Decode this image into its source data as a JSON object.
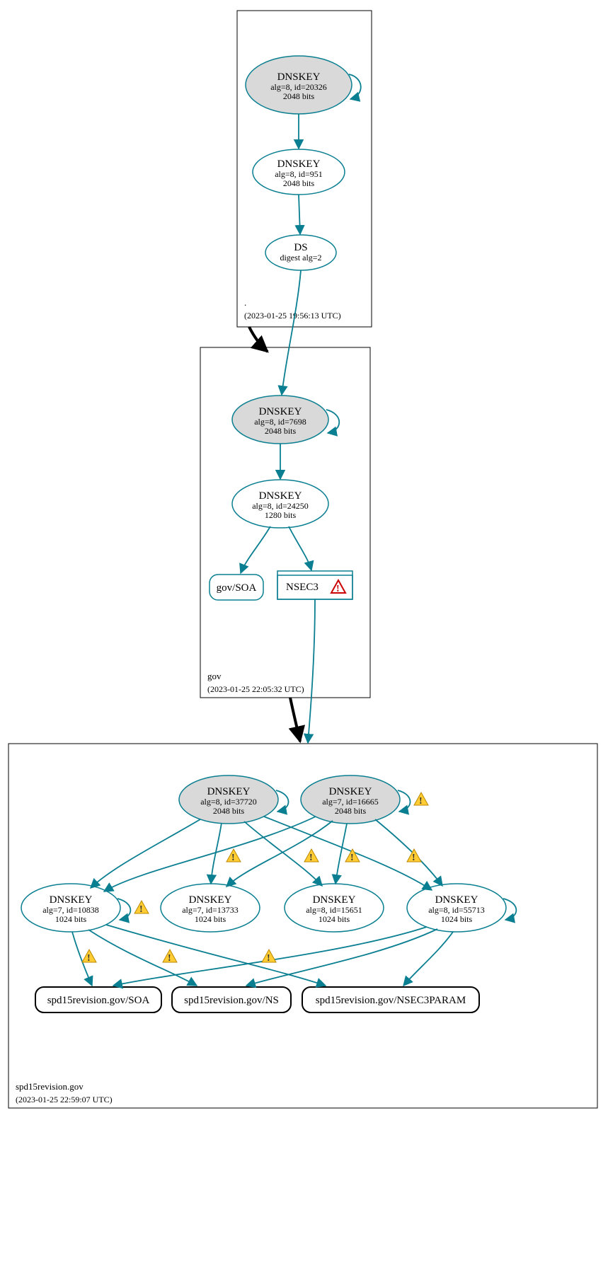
{
  "zones": {
    "root": {
      "name": ".",
      "ts": "(2023-01-25 19:56:13 UTC)"
    },
    "gov": {
      "name": "gov",
      "ts": "(2023-01-25 22:05:32 UTC)"
    },
    "leaf": {
      "name": "spd15revision.gov",
      "ts": "(2023-01-25 22:59:07 UTC)"
    }
  },
  "nodes": {
    "root_ksk": {
      "t": "DNSKEY",
      "l1": "alg=8, id=20326",
      "l2": "2048 bits"
    },
    "root_zsk": {
      "t": "DNSKEY",
      "l1": "alg=8, id=951",
      "l2": "2048 bits"
    },
    "root_ds": {
      "t": "DS",
      "l1": "digest alg=2"
    },
    "gov_ksk": {
      "t": "DNSKEY",
      "l1": "alg=8, id=7698",
      "l2": "2048 bits"
    },
    "gov_zsk": {
      "t": "DNSKEY",
      "l1": "alg=8, id=24250",
      "l2": "1280 bits"
    },
    "gov_soa": {
      "t": "gov/SOA"
    },
    "gov_nsec3": {
      "t": "NSEC3"
    },
    "leaf_ksk8": {
      "t": "DNSKEY",
      "l1": "alg=8, id=37720",
      "l2": "2048 bits"
    },
    "leaf_ksk7": {
      "t": "DNSKEY",
      "l1": "alg=7, id=16665",
      "l2": "2048 bits"
    },
    "leaf_z1": {
      "t": "DNSKEY",
      "l1": "alg=7, id=10838",
      "l2": "1024 bits"
    },
    "leaf_z2": {
      "t": "DNSKEY",
      "l1": "alg=7, id=13733",
      "l2": "1024 bits"
    },
    "leaf_z3": {
      "t": "DNSKEY",
      "l1": "alg=8, id=15651",
      "l2": "1024 bits"
    },
    "leaf_z4": {
      "t": "DNSKEY",
      "l1": "alg=8, id=55713",
      "l2": "1024 bits"
    },
    "leaf_soa": {
      "t": "spd15revision.gov/SOA"
    },
    "leaf_ns": {
      "t": "spd15revision.gov/NS"
    },
    "leaf_n3p": {
      "t": "spd15revision.gov/NSEC3PARAM"
    }
  }
}
